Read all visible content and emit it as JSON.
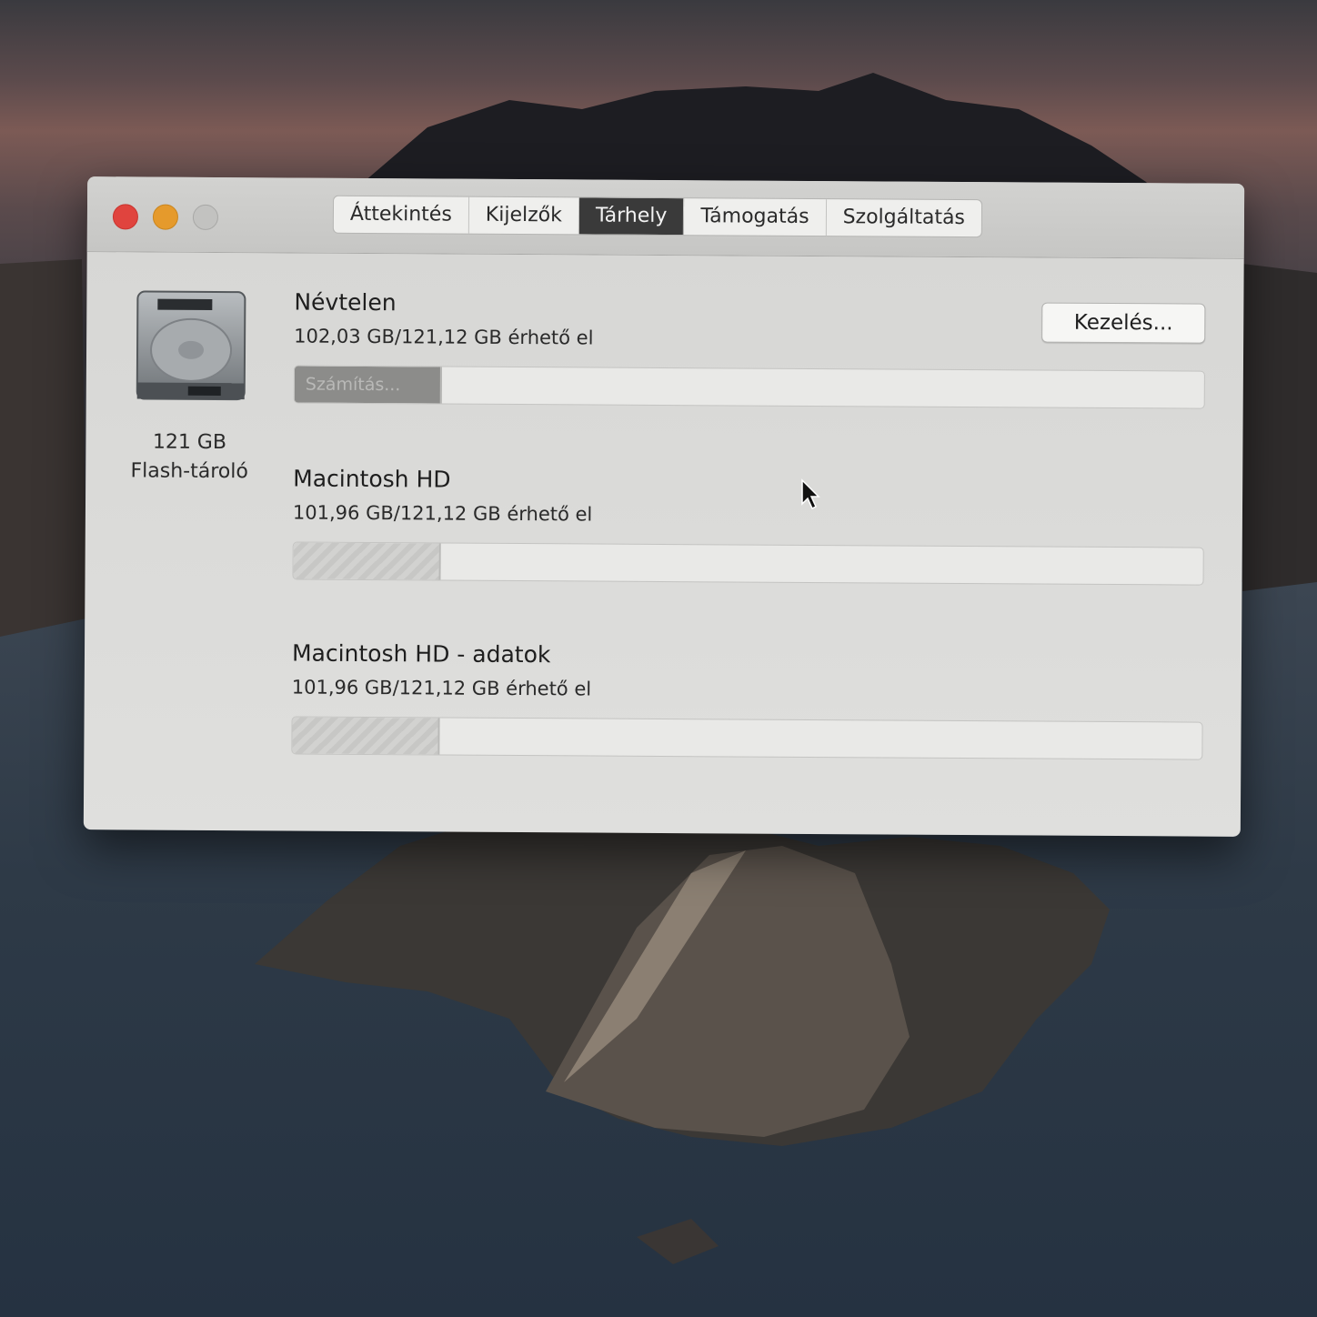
{
  "window": {
    "tabs": [
      {
        "label": "Áttekintés",
        "active": false
      },
      {
        "label": "Kijelzők",
        "active": false
      },
      {
        "label": "Tárhely",
        "active": true
      },
      {
        "label": "Támogatás",
        "active": false
      },
      {
        "label": "Szolgáltatás",
        "active": false
      }
    ]
  },
  "disk": {
    "icon": "hard-drive-icon",
    "capacity": "121 GB",
    "type": "Flash-tároló"
  },
  "manage_button": "Kezelés...",
  "volumes": [
    {
      "name": "Névtelen",
      "available": "102,03 GB/121,12 GB érhető el",
      "bar_label": "Számítás...",
      "used_fraction": 0.16,
      "calculating": true
    },
    {
      "name": "Macintosh HD",
      "available": "101,96 GB/121,12 GB érhető el",
      "bar_label": "",
      "used_fraction": 0.16,
      "calculating": false
    },
    {
      "name": "Macintosh HD - adatok",
      "available": "101,96 GB/121,12 GB érhető el",
      "bar_label": "",
      "used_fraction": 0.16,
      "calculating": false
    }
  ],
  "colors": {
    "close": "#e0443e",
    "minimize": "#e59a2c",
    "zoom": "#c2c2c0",
    "active_tab": "#3a3a3a"
  }
}
